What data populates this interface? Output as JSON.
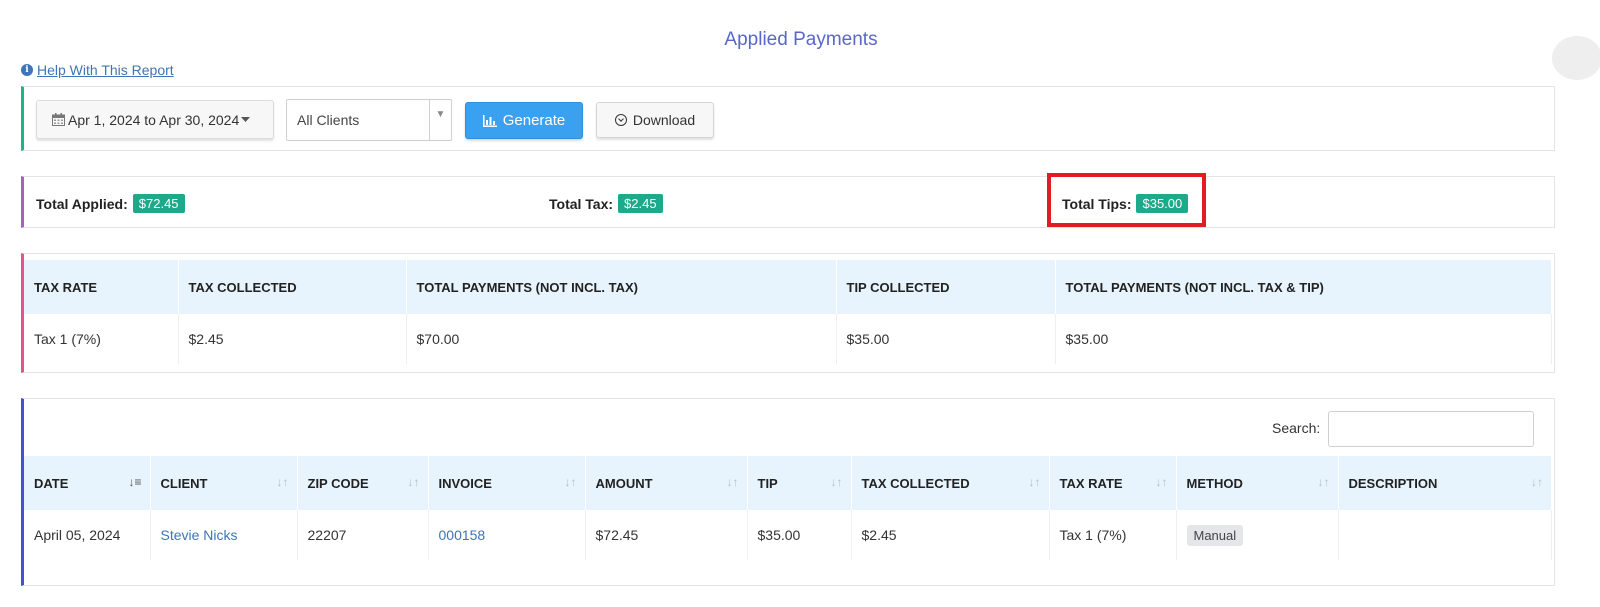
{
  "page": {
    "title": "Applied Payments",
    "help_link": "Help With This Report"
  },
  "filters": {
    "date_range": "Apr 1, 2024 to Apr 30, 2024",
    "client_select": "All Clients",
    "generate_label": "Generate",
    "download_label": "Download"
  },
  "totals": {
    "applied_label": "Total Applied:",
    "applied_value": "$72.45",
    "tax_label": "Total Tax:",
    "tax_value": "$2.45",
    "tips_label": "Total Tips:",
    "tips_value": "$35.00"
  },
  "tax_table": {
    "headers": [
      "TAX RATE",
      "TAX COLLECTED",
      "TOTAL PAYMENTS (NOT INCL. TAX)",
      "TIP COLLECTED",
      "TOTAL PAYMENTS (NOT INCL. TAX & TIP)"
    ],
    "rows": [
      [
        "Tax 1 (7%)",
        "$2.45",
        "$70.00",
        "$35.00",
        "$35.00"
      ]
    ]
  },
  "payments_table": {
    "search_label": "Search:",
    "search_value": "",
    "headers": [
      "DATE",
      "CLIENT",
      "ZIP CODE",
      "INVOICE",
      "AMOUNT",
      "TIP",
      "TAX COLLECTED",
      "TAX RATE",
      "METHOD",
      "DESCRIPTION"
    ],
    "rows": [
      {
        "date": "April 05, 2024",
        "client": "Stevie Nicks",
        "zip": "22207",
        "invoice": "000158",
        "amount": "$72.45",
        "tip": "$35.00",
        "tax_collected": "$2.45",
        "tax_rate": "Tax 1 (7%)",
        "method": "Manual",
        "description": ""
      }
    ]
  },
  "colors": {
    "accent": "#5867c9",
    "badge": "#1daa8a",
    "generate": "#3aa0f0",
    "highlight": "#e31b23",
    "header_bg": "#e7f4fd"
  },
  "icons": [
    "info-icon",
    "calendar-icon",
    "caret-down-icon",
    "bar-chart-icon",
    "download-icon",
    "sort-icon",
    "sort-asc-icon"
  ]
}
